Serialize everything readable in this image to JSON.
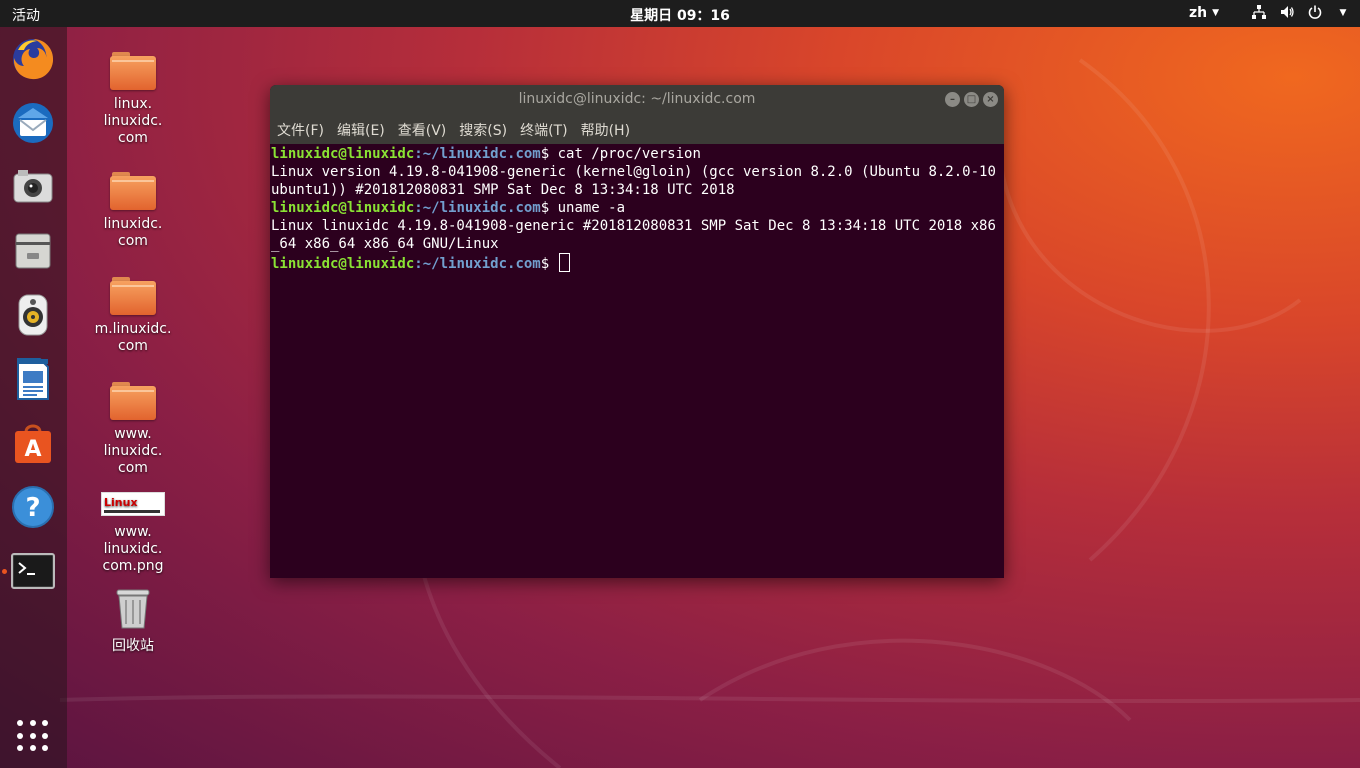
{
  "topbar": {
    "activities": "活动",
    "clock": "星期日 09：16",
    "lang": "zh",
    "icons": [
      "network-icon",
      "volume-icon",
      "power-icon",
      "chevron-down-icon"
    ]
  },
  "dock": {
    "items": [
      {
        "name": "firefox"
      },
      {
        "name": "thunderbird"
      },
      {
        "name": "shotwell"
      },
      {
        "name": "files"
      },
      {
        "name": "rhythmbox"
      },
      {
        "name": "libreoffice-writer"
      },
      {
        "name": "ubuntu-software"
      },
      {
        "name": "help"
      },
      {
        "name": "terminal",
        "running": true
      }
    ]
  },
  "desktop": {
    "icons": [
      {
        "label": "linux.\nlinuxidc.\ncom",
        "type": "folder"
      },
      {
        "label": "linuxidc.\ncom",
        "type": "folder"
      },
      {
        "label": "m.linuxidc.\ncom",
        "type": "folder"
      },
      {
        "label": "www.\nlinuxidc.\ncom",
        "type": "folder"
      },
      {
        "label": "www.\nlinuxidc.\ncom.png",
        "type": "image",
        "logo": "Linux"
      },
      {
        "label": "回收站",
        "type": "trash"
      }
    ]
  },
  "terminal": {
    "title": "linuxidc@linuxidc: ~/linuxidc.com",
    "menu": [
      "文件(F)",
      "编辑(E)",
      "查看(V)",
      "搜索(S)",
      "终端(T)",
      "帮助(H)"
    ],
    "prompt_user": "linuxidc@linuxidc",
    "prompt_path": ":~/linuxidc.com",
    "prompt_sym": "$ ",
    "cmd1": "cat /proc/version",
    "out1": "Linux version 4.19.8-041908-generic (kernel@gloin) (gcc version 8.2.0 (Ubuntu 8.2.0-10ubuntu1)) #201812080831 SMP Sat Dec 8 13:34:18 UTC 2018",
    "cmd2": "uname -a",
    "out2": "Linux linuxidc 4.19.8-041908-generic #201812080831 SMP Sat Dec 8 13:34:18 UTC 2018 x86_64 x86_64 x86_64 GNU/Linux"
  },
  "colors": {
    "prompt_user": "#8ae234",
    "prompt_path": "#729fcf",
    "terminal_bg": "#2c001e",
    "accent": "#e95420"
  }
}
